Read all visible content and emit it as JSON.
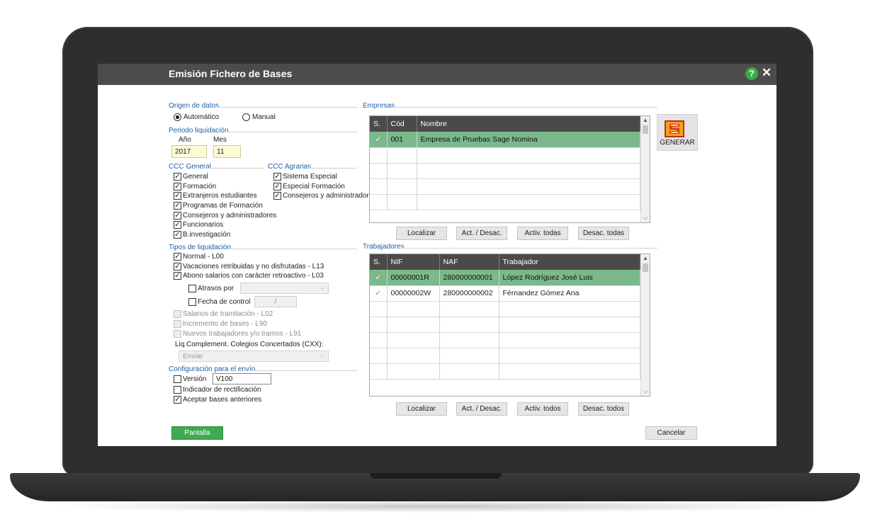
{
  "window": {
    "title": "Emisión Fichero de Bases"
  },
  "origen": {
    "title": "Origen de datos",
    "auto_label": "Automático",
    "manual_label": "Manual",
    "selected": "Automático"
  },
  "periodo": {
    "title": "Periodo liquidación",
    "year_label": "Año",
    "month_label": "Mes",
    "year": "2017",
    "month": "11"
  },
  "ccc_general": {
    "title": "CCC General",
    "items": [
      {
        "label": "General",
        "checked": true
      },
      {
        "label": "Formación",
        "checked": true
      },
      {
        "label": "Extranjeros estudiantes",
        "checked": true
      },
      {
        "label": "Programas de Formación",
        "checked": true
      },
      {
        "label": "Consejeros y administradores",
        "checked": true
      },
      {
        "label": "Funcionarios",
        "checked": true
      },
      {
        "label": "B.investigación",
        "checked": true
      }
    ]
  },
  "ccc_agrarias": {
    "title": "CCC Agrarias",
    "items": [
      {
        "label": "Sistema Especial",
        "checked": true
      },
      {
        "label": "Especial Formación",
        "checked": true
      },
      {
        "label": "Consejeros y administradores",
        "checked": true
      }
    ]
  },
  "tipos": {
    "title": "Tipos de liquidación",
    "items": [
      {
        "label": "Normal - L00",
        "checked": true
      },
      {
        "label": "Vacaciones retribuidas y no disfrutadas - L13",
        "checked": true
      },
      {
        "label": "Abono salarios con carácter retroactivo - L03",
        "checked": true
      }
    ],
    "atrasos_label": "Atrasos por",
    "fecha_label": "Fecha de control",
    "fecha_value": "/",
    "disabled_items": [
      "Salarios de tramitación - L02",
      "Incremento de bases - L90",
      "Nuevos trabajadores y/o tramos - L91"
    ],
    "liq_label": "Liq.Complement. Colegios Concertados (CXX):",
    "liq_select": "Enviar"
  },
  "config": {
    "title": "Configuración para el envío",
    "version_label": "Versión",
    "version_value": "V100",
    "rectificacion_label": "Indicador de rectificación",
    "aceptar_label": "Aceptar bases anteriores",
    "aceptar_checked": true
  },
  "empresas": {
    "title": "Empresas",
    "columns": [
      "S.",
      "Cód",
      "Nombre"
    ],
    "rows": [
      {
        "selected": true,
        "check": "✓",
        "cod": "001",
        "nombre": "Empresa de Pruebas Sage Nomina"
      }
    ],
    "buttons": [
      "Localizar",
      "Act. / Desac.",
      "Activ. todas",
      "Desac. todas"
    ]
  },
  "trabajadores": {
    "title": "Trabajadores",
    "columns": [
      "S.",
      "NIF",
      "NAF",
      "Trabajador"
    ],
    "rows": [
      {
        "selected": true,
        "check": "✓",
        "nif": "00000001R",
        "naf": "280000000001",
        "nombre": "López Rodríguez José Luis"
      },
      {
        "selected": false,
        "check": "✓",
        "nif": "00000002W",
        "naf": "280000000002",
        "nombre": "Férnandez Gómez Ana"
      }
    ],
    "buttons": [
      "Localizar",
      "Act. / Desac.",
      "Activ. todos",
      "Desac. todos"
    ]
  },
  "actions": {
    "generar": "GENERAR",
    "pantalla": "Pantalla",
    "cancelar": "Cancelar"
  },
  "colors": {
    "titlebar": "#4c4c4c",
    "section_title": "#1f5fa8",
    "selected_row": "#7bb88c",
    "accent_green": "#3faa4f"
  }
}
